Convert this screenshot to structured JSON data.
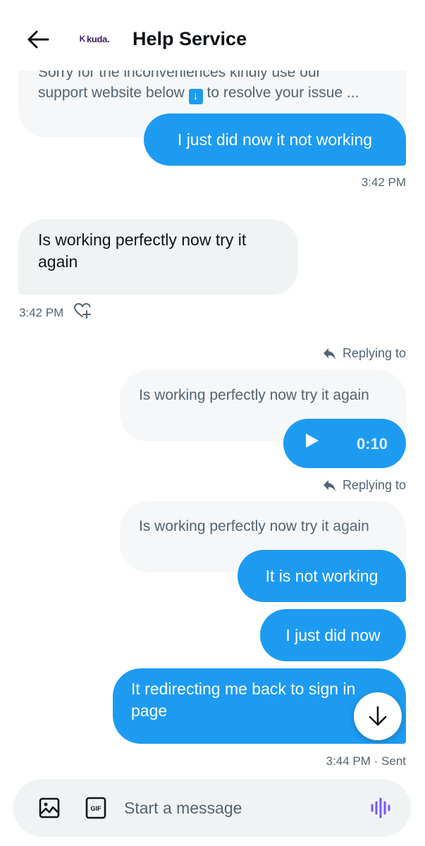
{
  "header": {
    "title": "Help Service",
    "avatar_logo": "kuda.",
    "avatar_logo_mark": "K"
  },
  "colors": {
    "accent": "#1d9bf0",
    "incoming_bubble": "#eff3f4",
    "secondary_text": "#536471",
    "voice_icon": "#7856ff",
    "brand_logo": "#40196d"
  },
  "messages": [
    {
      "direction": "incoming",
      "text_line1": "Sorry for the inconveniences kindly use our",
      "text_line2_before": "support website below",
      "emoji": "↓",
      "text_line2_after": "to resolve your issue ...",
      "truncated": true
    },
    {
      "direction": "outgoing",
      "text": "I just did now it not working",
      "timestamp": "3:42 PM"
    },
    {
      "direction": "incoming",
      "text": "Is working perfectly now try it again",
      "timestamp": "3:42 PM",
      "reaction_icon": "heart-plus-icon"
    },
    {
      "direction": "outgoing",
      "reply_label": "Replying to",
      "quoted_text": "Is working perfectly now try it again",
      "type": "voice",
      "duration": "0:10"
    },
    {
      "direction": "outgoing",
      "reply_label": "Replying to",
      "quoted_text": "Is working perfectly now try it again",
      "text": "It is not working"
    },
    {
      "direction": "outgoing",
      "text": "I just did now"
    },
    {
      "direction": "outgoing",
      "text": "It redirecting me back to sign in page",
      "timestamp": "3:44 PM · Sent"
    }
  ],
  "composer": {
    "placeholder": "Start a message",
    "gif_label": "GIF"
  }
}
